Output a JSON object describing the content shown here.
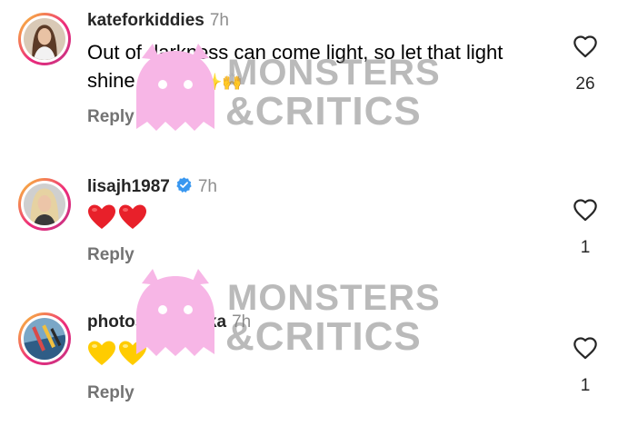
{
  "comments": [
    {
      "username": "kateforkiddies",
      "time": "7h",
      "text": "Out of darkness can come light, so let that light shine bright.",
      "text_emojis": "✨🙌",
      "reply_label": "Reply",
      "likes": "26",
      "avatar": "woman-brown-hair"
    },
    {
      "username": "lisajh1987",
      "time": "7h",
      "verified": true,
      "emojis": [
        "red-heart-emoji",
        "red-heart-emoji"
      ],
      "reply_label": "Reply",
      "likes": "1",
      "avatar": "woman-blonde-hair"
    },
    {
      "username": "photosofsrilanka",
      "time": "7h",
      "emojis": [
        "yellow-heart-emoji",
        "yellow-heart-emoji"
      ],
      "reply_label": "Reply",
      "likes": "1",
      "avatar": "colorful-art"
    }
  ],
  "watermark": {
    "line1": "MONSTERS",
    "line2": "&CRITICS",
    "mascot_color": "#f7b6e6"
  },
  "colors": {
    "verified": "#3897f0",
    "heart_red": "#e8202a",
    "heart_yellow": "#ffcc00",
    "secondary_text": "#737373",
    "avatar_ring": "#ee2a7b"
  }
}
